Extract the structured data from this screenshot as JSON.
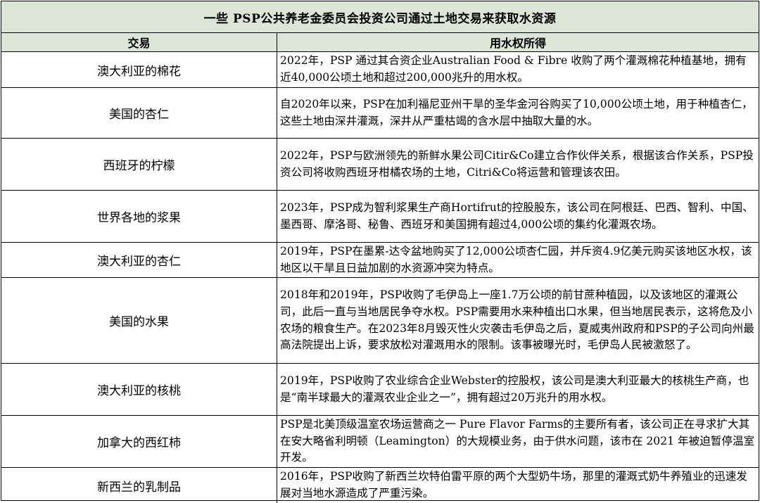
{
  "table": {
    "title": "一些 PSP公共养老金委员会投资公司通过土地交易来获取水资源",
    "headers": [
      "交易",
      "用水权所得"
    ],
    "rows": [
      {
        "deal": "澳大利亚的棉花",
        "water": "2022年，PSP 通过其合资企业Australian Food & Fibre 收购了两个灌溉棉花种植基地，拥有近40,000公顷土地和超过200,000兆升的用水权。"
      },
      {
        "deal": "美国的杏仁",
        "water": "自2020年以来，PSP在加利福尼亚州干旱的圣华金河谷购买了10,000公顷土地，用于种植杏仁，这些土地由深井灌溉，深井从严重枯竭的含水层中抽取大量的水。"
      },
      {
        "deal": "西班牙的柠檬",
        "water": "2022年，PSP与欧洲领先的新鲜水果公司Citir&Co建立合作伙伴关系，根据该合作关系，PSP投资公司将收购西班牙柑橘农场的土地，Citri&Co将运营和管理该农田。"
      },
      {
        "deal": "世界各地的浆果",
        "water": "2023年，PSP成为智利浆果生产商Hortifrut的控股股东，该公司在阿根廷、巴西、智利、中国、墨西哥、摩洛哥、秘鲁、西班牙和美国拥有超过4,000公顷的集约化灌溉农场。"
      },
      {
        "deal": "澳大利亚的杏仁",
        "water": "2019年，PSP在墨累-达令盆地购买了12,000公顷杏仁园，并斥资4.9亿美元购买该地区水权，该地区以干旱且日益加剧的水资源冲突为特点。"
      },
      {
        "deal": "美国的水果",
        "water": "2018年和2019年，PSP收购了毛伊岛上一座1.7万公顷的前甘蔗种植园，以及该地区的灌溉公司，此后一直与当地居民争夺水权。PSP需要用水来种植出口水果，但当地居民表示，这将危及小农场的粮食生产。在2023年8月毁灭性火灾袭击毛伊岛之后，夏威夷州政府和PSP的子公司向州最高法院提出上诉，要求放松对灌溉用水的限制。该事被曝光时，毛伊岛人民被激怒了。"
      },
      {
        "deal": "澳大利亚的核桃",
        "water": "2019年，PSP收购了农业综合企业Webster的控股权，该公司是澳大利亚最大的核桃生产商，也是“南半球最大的灌溉农业企业之一”，拥有超过20万兆升的用水权。"
      },
      {
        "deal": "加拿大的西红柿",
        "water": "PSP是北美顶级温室农场运营商之一 Pure Flavor Farms的主要所有者，该公司正在寻求扩大其在安大略省利明顿（Leamington）的大规模业务，由于供水问题，该市在 2021 年被迫暂停温室开发。"
      },
      {
        "deal": "新西兰的乳制品",
        "water": "2016年，PSP收购了新西兰坎特伯雷平原的两个大型奶牛场，那里的灌溉式奶牛养殖业的迅速发展对当地水源造成了严重污染。"
      }
    ]
  }
}
